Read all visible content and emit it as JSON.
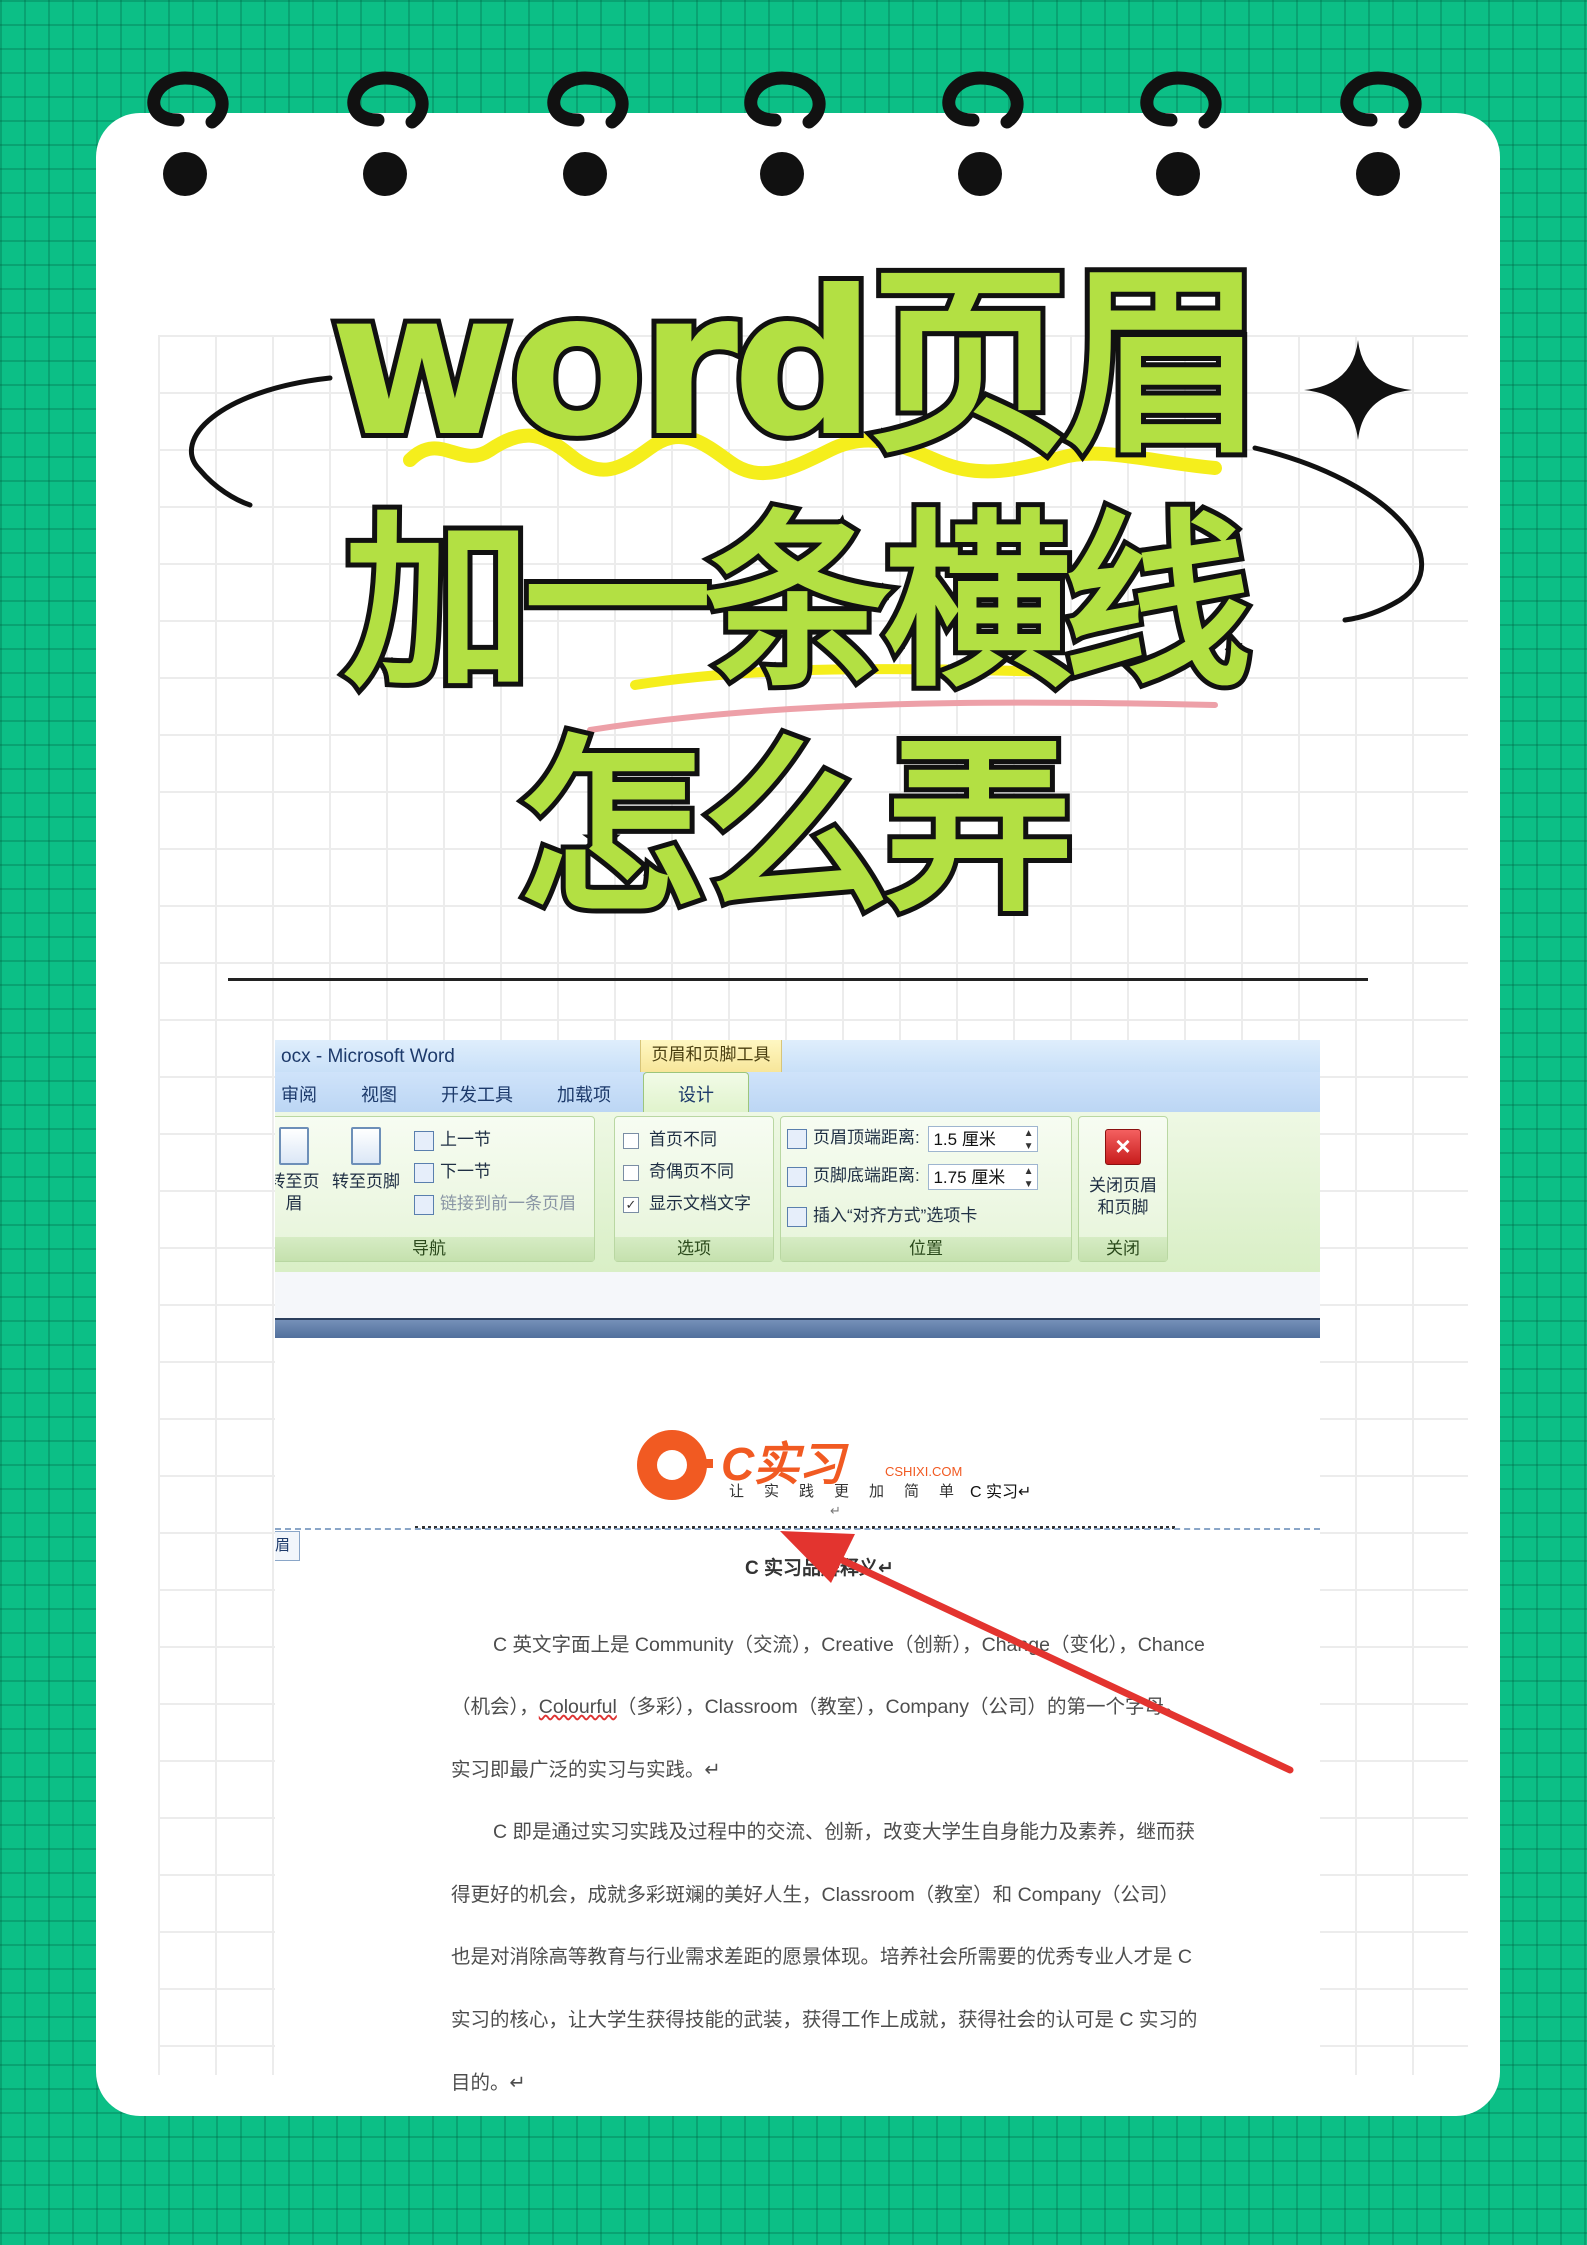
{
  "headline": {
    "line1": "word页眉",
    "line2": "加一条横线",
    "line3": "怎么弄"
  },
  "colors": {
    "background": "#0cbf86",
    "title_fill": "#b3e043",
    "title_stroke": "#111111",
    "logo_orange": "#f15a22"
  },
  "word": {
    "window_title": "ocx - Microsoft Word",
    "context_tools": "页眉和页脚工具",
    "tabs": [
      "审阅",
      "视图",
      "开发工具",
      "加载项"
    ],
    "active_tab": "设计",
    "nav": {
      "goto_header": "转至页眉",
      "goto_footer": "转至页脚",
      "prev_section": "上一节",
      "next_section": "下一节",
      "link_previous": "链接到前一条页眉",
      "group_label": "导航"
    },
    "options": {
      "first_page": "首页不同",
      "odd_even": "奇偶页不同",
      "show_text": "显示文档文字",
      "show_text_checked": true,
      "group_label": "选项"
    },
    "position": {
      "header_top_label": "页眉顶端距离:",
      "header_top_value": "1.5 厘米",
      "footer_bottom_label": "页脚底端距离:",
      "footer_bottom_value": "1.75 厘米",
      "insert_align_tab": "插入“对齐方式”选项卡",
      "group_label": "位置"
    },
    "close": {
      "button_label_1": "关闭页眉",
      "button_label_2": "和页脚",
      "group_label": "关闭"
    }
  },
  "document": {
    "logo_text": "C实习",
    "logo_domain": "CSHIXI.COM",
    "logo_slogan": "让实践更加简单",
    "header_text": "C 实习↵",
    "para_mark": "↵",
    "header_tag": "眉",
    "title": "C 实习品牌释义↵",
    "lines": [
      "C 英文字面上是 Community（交流），Creative（创新），Change（变化），Chance",
      "（机会），",
      "实习即最广泛的实习与实践。↵",
      "C 即是通过实习实践及过程中的交流、创新，改变大学生自身能力及素养，继而获",
      "得更好的机会，成就多彩斑斓的美好人生，Classroom（教室）和 Company（公司）",
      "也是对消除高等教育与行业需求差距的愿景体现。培养社会所需要的优秀专业人才是 C",
      "实习的核心，让大学生获得技能的武装，获得工作上成就，获得社会的认可是 C 实习的",
      "目的。↵"
    ],
    "line2_wavy": "Colourful",
    "line2_rest": "（多彩），Classroom（教室），Company（公司）的第一个字母。"
  }
}
